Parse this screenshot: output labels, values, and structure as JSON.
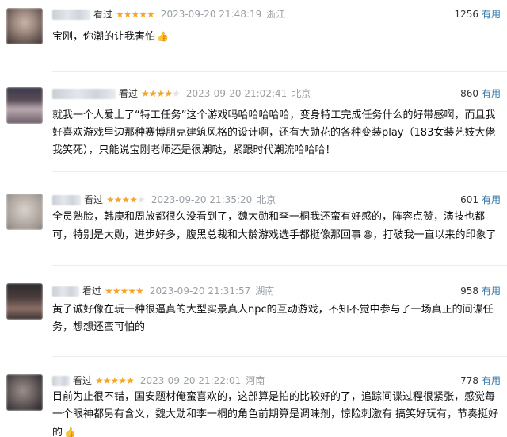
{
  "colors": {
    "star_on": "#f4a52b",
    "star_off": "#e3e3e3",
    "meta_gray": "#9aa0a6",
    "useful_link": "#3377aa"
  },
  "comments": [
    {
      "status": "看过",
      "rating": 5,
      "stars_text": "★★★★★",
      "stars_off_text": "",
      "time": "2023-09-20 21:48:19",
      "location": "浙江",
      "votes": "1256",
      "useful_label": "有用",
      "content": "宝刚，你潮的让我害怕",
      "emoji": "👍",
      "avatar_colors": [
        "#6a5a55",
        "#c8b4a8"
      ]
    },
    {
      "status": "看过",
      "rating": 4,
      "stars_text": "★★★★",
      "stars_off_text": "★",
      "time": "2023-09-20 21:02:41",
      "location": "北京",
      "votes": "860",
      "useful_label": "有用",
      "content": "就我一个人爱上了“特工任务”这个游戏吗哈哈哈哈哈，变身特工完成任务什么的好带感啊，而且我好喜欢游戏里边那种赛博朋克建筑风格的设计啊，还有大勋花的各种变装play（183女装艺妓大佬我笑死），只能说宝刚老师还是很潮哒，紧跟时代潮流哈哈哈！",
      "emoji": "",
      "avatar_colors": [
        "#3a3a4a",
        "#b9a8b0"
      ]
    },
    {
      "status": "看过",
      "rating": 4,
      "stars_text": "★★★★",
      "stars_off_text": "★",
      "time": "2023-09-20 21:35:20",
      "location": "北京",
      "votes": "601",
      "useful_label": "有用",
      "content": "全员熟脸，韩庚和周放都很久没看到了，魏大勋和李一桐我还蛮有好感的，阵容点赞，演技也都可，特别是大勋，进步好多，腹黑总裁和大龄游戏选手都挺像那回事",
      "content_tail": "，打破我一直以来的印象了",
      "emoji": "😆",
      "avatar_colors": [
        "#a09a94",
        "#d9d2cc"
      ]
    },
    {
      "status": "看过",
      "rating": 5,
      "stars_text": "★★★★★",
      "stars_off_text": "",
      "time": "2023-09-20 21:31:57",
      "location": "湖南",
      "votes": "958",
      "useful_label": "有用",
      "content": "黄子诚好像在玩一种很逼真的大型实景真人npc的互动游戏，不知不觉中参与了一场真正的间谍任务，想想还蛮可怕的",
      "emoji": "",
      "avatar_colors": [
        "#2d2a2c",
        "#8c6f66"
      ]
    },
    {
      "status": "看过",
      "rating": 5,
      "stars_text": "★★★★★",
      "stars_off_text": "",
      "time": "2023-09-20 21:22:01",
      "location": "河南",
      "votes": "778",
      "useful_label": "有用",
      "content": "目前为止很不错，国安题材俺蛮喜欢的，这部算是拍的比较好的了，追踪间谍过程很紧张，感觉每一个眼神都另有含义，魏大勋和李一桐的角色前期算是调味剂，惊险刺激有 搞笑好玩有，节奏挺好的",
      "emoji": "👍",
      "avatar_colors": [
        "#3b3638",
        "#9c8f8c"
      ]
    }
  ]
}
